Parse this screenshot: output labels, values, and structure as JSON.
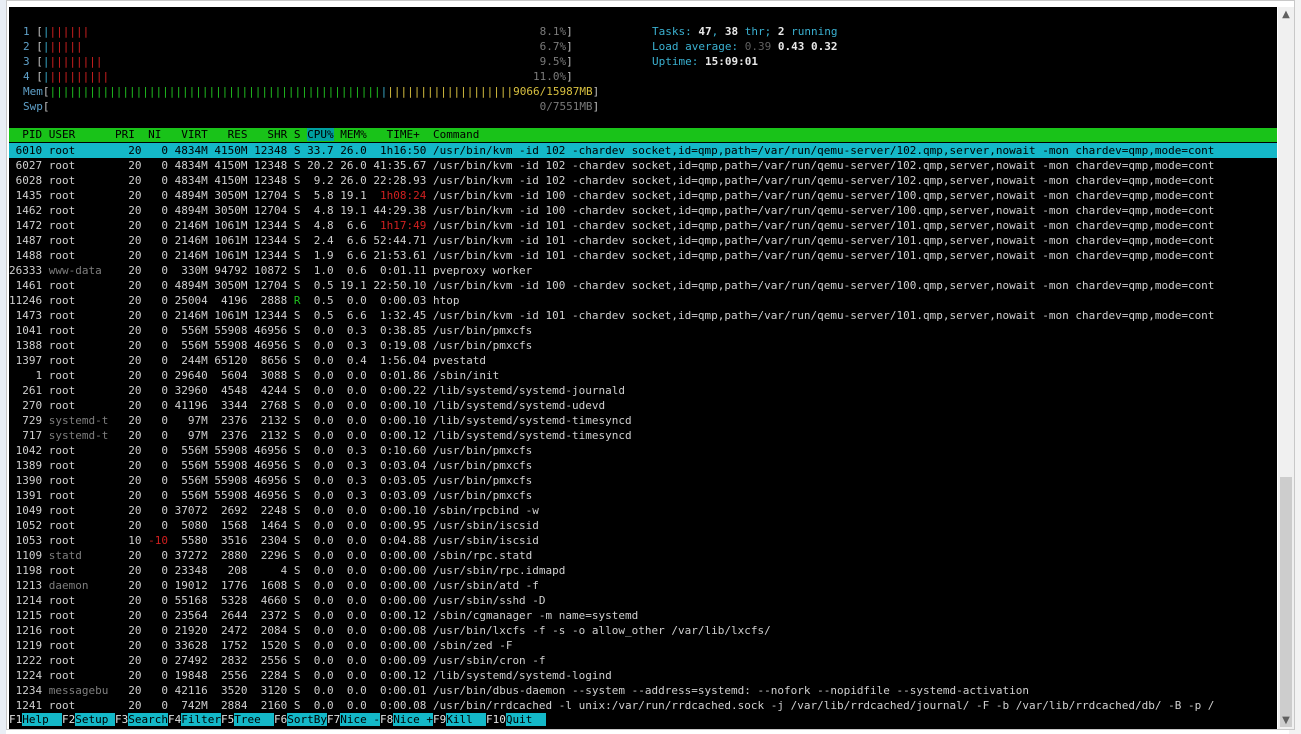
{
  "meters": {
    "cpus": [
      {
        "id": "1",
        "bar": "|||||||",
        "percent": "8.1%"
      },
      {
        "id": "2",
        "bar": "||||||",
        "percent": "6.7%"
      },
      {
        "id": "3",
        "bar": "|||||||||",
        "percent": "9.5%"
      },
      {
        "id": "4",
        "bar": "||||||||||",
        "percent": "11.0%"
      }
    ],
    "mem": {
      "label": "Mem",
      "bar": "||||||||||||||||||||||||||||||||||||||||||||||||||||||||||||||||||||||||||||||||||||||||",
      "value": "9066/15987MB"
    },
    "swp": {
      "label": "Swp",
      "value": "0/7551MB"
    }
  },
  "sysinfo": {
    "tasks_label": "Tasks:",
    "tasks": "47",
    "thr": "38",
    "thr_label": "thr;",
    "running": "2",
    "running_label": "running",
    "load_label": "Load average:",
    "load1": "0.39",
    "load5": "0.43",
    "load15": "0.32",
    "uptime_label": "Uptime:",
    "uptime": "15:09:01"
  },
  "header": {
    "pid": "  PID",
    "user": "USER     ",
    "pri": "PRI",
    "ni": " NI",
    "virt": "  VIRT",
    "res": "  RES",
    "shr": "  SHR",
    "s": "S",
    "cpu": "CPU%",
    "mem": "MEM%",
    "time": "  TIME+",
    "command": "Command"
  },
  "processes": [
    {
      "pid": "6010",
      "user": "root",
      "pri": "20",
      "ni": "0",
      "virt": "4834M",
      "res": "4150M",
      "shr": "12348",
      "s": "S",
      "cpu": "33.7",
      "mem": "26.0",
      "time": "1h16:50",
      "cmd": "/usr/bin/kvm -id 102 -chardev socket,id=qmp,path=/var/run/qemu-server/102.qmp,server,nowait -mon chardev=qmp,mode=cont",
      "selected": true
    },
    {
      "pid": "6027",
      "user": "root",
      "pri": "20",
      "ni": "0",
      "virt": "4834M",
      "res": "4150M",
      "shr": "12348",
      "s": "S",
      "cpu": "20.2",
      "mem": "26.0",
      "time": "41:35.67",
      "cmd": "/usr/bin/kvm -id 102 -chardev socket,id=qmp,path=/var/run/qemu-server/102.qmp,server,nowait -mon chardev=qmp,mode=cont"
    },
    {
      "pid": "6028",
      "user": "root",
      "pri": "20",
      "ni": "0",
      "virt": "4834M",
      "res": "4150M",
      "shr": "12348",
      "s": "S",
      "cpu": "9.2",
      "mem": "26.0",
      "time": "22:28.93",
      "cmd": "/usr/bin/kvm -id 102 -chardev socket,id=qmp,path=/var/run/qemu-server/102.qmp,server,nowait -mon chardev=qmp,mode=cont"
    },
    {
      "pid": "1435",
      "user": "root",
      "pri": "20",
      "ni": "0",
      "virt": "4894M",
      "res": "3050M",
      "shr": "12704",
      "s": "S",
      "cpu": "5.8",
      "mem": "19.1",
      "time": "1h08:24",
      "cmd": "/usr/bin/kvm -id 100 -chardev socket,id=qmp,path=/var/run/qemu-server/100.qmp,server,nowait -mon chardev=qmp,mode=cont",
      "hour": true
    },
    {
      "pid": "1462",
      "user": "root",
      "pri": "20",
      "ni": "0",
      "virt": "4894M",
      "res": "3050M",
      "shr": "12704",
      "s": "S",
      "cpu": "4.8",
      "mem": "19.1",
      "time": "44:29.38",
      "cmd": "/usr/bin/kvm -id 100 -chardev socket,id=qmp,path=/var/run/qemu-server/100.qmp,server,nowait -mon chardev=qmp,mode=cont"
    },
    {
      "pid": "1472",
      "user": "root",
      "pri": "20",
      "ni": "0",
      "virt": "2146M",
      "res": "1061M",
      "shr": "12344",
      "s": "S",
      "cpu": "4.8",
      "mem": "6.6",
      "time": "1h17:49",
      "cmd": "/usr/bin/kvm -id 101 -chardev socket,id=qmp,path=/var/run/qemu-server/101.qmp,server,nowait -mon chardev=qmp,mode=cont",
      "hour": true
    },
    {
      "pid": "1487",
      "user": "root",
      "pri": "20",
      "ni": "0",
      "virt": "2146M",
      "res": "1061M",
      "shr": "12344",
      "s": "S",
      "cpu": "2.4",
      "mem": "6.6",
      "time": "52:44.71",
      "cmd": "/usr/bin/kvm -id 101 -chardev socket,id=qmp,path=/var/run/qemu-server/101.qmp,server,nowait -mon chardev=qmp,mode=cont"
    },
    {
      "pid": "1488",
      "user": "root",
      "pri": "20",
      "ni": "0",
      "virt": "2146M",
      "res": "1061M",
      "shr": "12344",
      "s": "S",
      "cpu": "1.9",
      "mem": "6.6",
      "time": "21:53.61",
      "cmd": "/usr/bin/kvm -id 101 -chardev socket,id=qmp,path=/var/run/qemu-server/101.qmp,server,nowait -mon chardev=qmp,mode=cont"
    },
    {
      "pid": "26333",
      "user": "www-data",
      "pri": "20",
      "ni": "0",
      "virt": "330M",
      "res": "94792",
      "shr": "10872",
      "s": "S",
      "cpu": "1.0",
      "mem": "0.6",
      "time": "0:01.11",
      "cmd": "pveproxy worker",
      "dimuser": true
    },
    {
      "pid": "1461",
      "user": "root",
      "pri": "20",
      "ni": "0",
      "virt": "4894M",
      "res": "3050M",
      "shr": "12704",
      "s": "S",
      "cpu": "0.5",
      "mem": "19.1",
      "time": "22:50.10",
      "cmd": "/usr/bin/kvm -id 100 -chardev socket,id=qmp,path=/var/run/qemu-server/100.qmp,server,nowait -mon chardev=qmp,mode=cont"
    },
    {
      "pid": "11246",
      "user": "root",
      "pri": "20",
      "ni": "0",
      "virt": "25004",
      "res": "4196",
      "shr": "2888",
      "s": "R",
      "cpu": "0.5",
      "mem": "0.0",
      "time": "0:00.03",
      "cmd": "htop"
    },
    {
      "pid": "1473",
      "user": "root",
      "pri": "20",
      "ni": "0",
      "virt": "2146M",
      "res": "1061M",
      "shr": "12344",
      "s": "S",
      "cpu": "0.5",
      "mem": "6.6",
      "time": "1:32.45",
      "cmd": "/usr/bin/kvm -id 101 -chardev socket,id=qmp,path=/var/run/qemu-server/101.qmp,server,nowait -mon chardev=qmp,mode=cont"
    },
    {
      "pid": "1041",
      "user": "root",
      "pri": "20",
      "ni": "0",
      "virt": "556M",
      "res": "55908",
      "shr": "46956",
      "s": "S",
      "cpu": "0.0",
      "mem": "0.3",
      "time": "0:38.85",
      "cmd": "/usr/bin/pmxcfs"
    },
    {
      "pid": "1388",
      "user": "root",
      "pri": "20",
      "ni": "0",
      "virt": "556M",
      "res": "55908",
      "shr": "46956",
      "s": "S",
      "cpu": "0.0",
      "mem": "0.3",
      "time": "0:19.08",
      "cmd": "/usr/bin/pmxcfs"
    },
    {
      "pid": "1397",
      "user": "root",
      "pri": "20",
      "ni": "0",
      "virt": "244M",
      "res": "65120",
      "shr": "8656",
      "s": "S",
      "cpu": "0.0",
      "mem": "0.4",
      "time": "1:56.04",
      "cmd": "pvestatd"
    },
    {
      "pid": "1",
      "user": "root",
      "pri": "20",
      "ni": "0",
      "virt": "29640",
      "res": "5604",
      "shr": "3088",
      "s": "S",
      "cpu": "0.0",
      "mem": "0.0",
      "time": "0:01.86",
      "cmd": "/sbin/init"
    },
    {
      "pid": "261",
      "user": "root",
      "pri": "20",
      "ni": "0",
      "virt": "32960",
      "res": "4548",
      "shr": "4244",
      "s": "S",
      "cpu": "0.0",
      "mem": "0.0",
      "time": "0:00.22",
      "cmd": "/lib/systemd/systemd-journald"
    },
    {
      "pid": "270",
      "user": "root",
      "pri": "20",
      "ni": "0",
      "virt": "41196",
      "res": "3344",
      "shr": "2768",
      "s": "S",
      "cpu": "0.0",
      "mem": "0.0",
      "time": "0:00.10",
      "cmd": "/lib/systemd/systemd-udevd"
    },
    {
      "pid": "729",
      "user": "systemd-t",
      "pri": "20",
      "ni": "0",
      "virt": "97M",
      "res": "2376",
      "shr": "2132",
      "s": "S",
      "cpu": "0.0",
      "mem": "0.0",
      "time": "0:00.10",
      "cmd": "/lib/systemd/systemd-timesyncd",
      "dimuser": true
    },
    {
      "pid": "717",
      "user": "systemd-t",
      "pri": "20",
      "ni": "0",
      "virt": "97M",
      "res": "2376",
      "shr": "2132",
      "s": "S",
      "cpu": "0.0",
      "mem": "0.0",
      "time": "0:00.12",
      "cmd": "/lib/systemd/systemd-timesyncd",
      "dimuser": true
    },
    {
      "pid": "1042",
      "user": "root",
      "pri": "20",
      "ni": "0",
      "virt": "556M",
      "res": "55908",
      "shr": "46956",
      "s": "S",
      "cpu": "0.0",
      "mem": "0.3",
      "time": "0:10.60",
      "cmd": "/usr/bin/pmxcfs"
    },
    {
      "pid": "1389",
      "user": "root",
      "pri": "20",
      "ni": "0",
      "virt": "556M",
      "res": "55908",
      "shr": "46956",
      "s": "S",
      "cpu": "0.0",
      "mem": "0.3",
      "time": "0:03.04",
      "cmd": "/usr/bin/pmxcfs"
    },
    {
      "pid": "1390",
      "user": "root",
      "pri": "20",
      "ni": "0",
      "virt": "556M",
      "res": "55908",
      "shr": "46956",
      "s": "S",
      "cpu": "0.0",
      "mem": "0.3",
      "time": "0:03.05",
      "cmd": "/usr/bin/pmxcfs"
    },
    {
      "pid": "1391",
      "user": "root",
      "pri": "20",
      "ni": "0",
      "virt": "556M",
      "res": "55908",
      "shr": "46956",
      "s": "S",
      "cpu": "0.0",
      "mem": "0.3",
      "time": "0:03.09",
      "cmd": "/usr/bin/pmxcfs"
    },
    {
      "pid": "1049",
      "user": "root",
      "pri": "20",
      "ni": "0",
      "virt": "37072",
      "res": "2692",
      "shr": "2248",
      "s": "S",
      "cpu": "0.0",
      "mem": "0.0",
      "time": "0:00.10",
      "cmd": "/sbin/rpcbind -w"
    },
    {
      "pid": "1052",
      "user": "root",
      "pri": "20",
      "ni": "0",
      "virt": "5080",
      "res": "1568",
      "shr": "1464",
      "s": "S",
      "cpu": "0.0",
      "mem": "0.0",
      "time": "0:00.95",
      "cmd": "/usr/sbin/iscsid"
    },
    {
      "pid": "1053",
      "user": "root",
      "pri": "10",
      "ni": "-10",
      "virt": "5580",
      "res": "3516",
      "shr": "2304",
      "s": "S",
      "cpu": "0.0",
      "mem": "0.0",
      "time": "0:04.88",
      "cmd": "/usr/sbin/iscsid",
      "nired": true
    },
    {
      "pid": "1109",
      "user": "statd",
      "pri": "20",
      "ni": "0",
      "virt": "37272",
      "res": "2880",
      "shr": "2296",
      "s": "S",
      "cpu": "0.0",
      "mem": "0.0",
      "time": "0:00.00",
      "cmd": "/sbin/rpc.statd",
      "dimuser": true
    },
    {
      "pid": "1198",
      "user": "root",
      "pri": "20",
      "ni": "0",
      "virt": "23348",
      "res": "208",
      "shr": "4",
      "s": "S",
      "cpu": "0.0",
      "mem": "0.0",
      "time": "0:00.00",
      "cmd": "/usr/sbin/rpc.idmapd"
    },
    {
      "pid": "1213",
      "user": "daemon",
      "pri": "20",
      "ni": "0",
      "virt": "19012",
      "res": "1776",
      "shr": "1608",
      "s": "S",
      "cpu": "0.0",
      "mem": "0.0",
      "time": "0:00.00",
      "cmd": "/usr/sbin/atd -f",
      "dimuser": true
    },
    {
      "pid": "1214",
      "user": "root",
      "pri": "20",
      "ni": "0",
      "virt": "55168",
      "res": "5328",
      "shr": "4660",
      "s": "S",
      "cpu": "0.0",
      "mem": "0.0",
      "time": "0:00.00",
      "cmd": "/usr/sbin/sshd -D"
    },
    {
      "pid": "1215",
      "user": "root",
      "pri": "20",
      "ni": "0",
      "virt": "23564",
      "res": "2644",
      "shr": "2372",
      "s": "S",
      "cpu": "0.0",
      "mem": "0.0",
      "time": "0:00.12",
      "cmd": "/sbin/cgmanager -m name=systemd"
    },
    {
      "pid": "1216",
      "user": "root",
      "pri": "20",
      "ni": "0",
      "virt": "21920",
      "res": "2472",
      "shr": "2084",
      "s": "S",
      "cpu": "0.0",
      "mem": "0.0",
      "time": "0:00.08",
      "cmd": "/usr/bin/lxcfs -f -s -o allow_other /var/lib/lxcfs/"
    },
    {
      "pid": "1219",
      "user": "root",
      "pri": "20",
      "ni": "0",
      "virt": "33628",
      "res": "1752",
      "shr": "1520",
      "s": "S",
      "cpu": "0.0",
      "mem": "0.0",
      "time": "0:00.00",
      "cmd": "/sbin/zed -F"
    },
    {
      "pid": "1222",
      "user": "root",
      "pri": "20",
      "ni": "0",
      "virt": "27492",
      "res": "2832",
      "shr": "2556",
      "s": "S",
      "cpu": "0.0",
      "mem": "0.0",
      "time": "0:00.09",
      "cmd": "/usr/sbin/cron -f"
    },
    {
      "pid": "1224",
      "user": "root",
      "pri": "20",
      "ni": "0",
      "virt": "19848",
      "res": "2556",
      "shr": "2284",
      "s": "S",
      "cpu": "0.0",
      "mem": "0.0",
      "time": "0:00.12",
      "cmd": "/lib/systemd/systemd-logind"
    },
    {
      "pid": "1234",
      "user": "messagebu",
      "pri": "20",
      "ni": "0",
      "virt": "42116",
      "res": "3520",
      "shr": "3120",
      "s": "S",
      "cpu": "0.0",
      "mem": "0.0",
      "time": "0:00.01",
      "cmd": "/usr/bin/dbus-daemon --system --address=systemd: --nofork --nopidfile --systemd-activation",
      "dimuser": true
    },
    {
      "pid": "1241",
      "user": "root",
      "pri": "20",
      "ni": "0",
      "virt": "742M",
      "res": "2884",
      "shr": "2160",
      "s": "S",
      "cpu": "0.0",
      "mem": "0.0",
      "time": "0:00.08",
      "cmd": "/usr/bin/rrdcached -l unix:/var/run/rrdcached.sock -j /var/lib/rrdcached/journal/ -F -b /var/lib/rrdcached/db/ -B -p /"
    }
  ],
  "footer": [
    {
      "key": "F1",
      "label": "Help  "
    },
    {
      "key": "F2",
      "label": "Setup "
    },
    {
      "key": "F3",
      "label": "Search"
    },
    {
      "key": "F4",
      "label": "Filter"
    },
    {
      "key": "F5",
      "label": "Tree  "
    },
    {
      "key": "F6",
      "label": "SortBy"
    },
    {
      "key": "F7",
      "label": "Nice -"
    },
    {
      "key": "F8",
      "label": "Nice +"
    },
    {
      "key": "F9",
      "label": "Kill  "
    },
    {
      "key": "F10",
      "label": "Quit  "
    }
  ]
}
